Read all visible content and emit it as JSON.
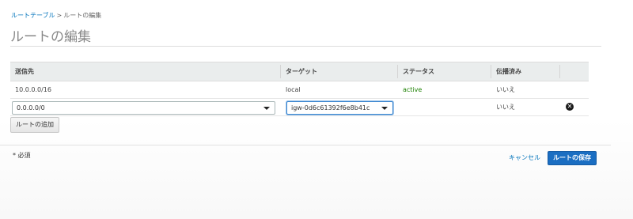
{
  "breadcrumb": {
    "parent": "ルートテーブル",
    "separator": ">",
    "current": "ルートの編集"
  },
  "page_title": "ルートの編集",
  "table": {
    "headers": {
      "destination": "送信先",
      "target": "ターゲット",
      "status": "ステータス",
      "propagated": "伝播済み"
    },
    "rows": [
      {
        "destination": "10.0.0.0/16",
        "target": "local",
        "status": "active",
        "propagated": "いいえ"
      }
    ],
    "edit_row": {
      "destination_value": "0.0.0.0/0",
      "target_value": "igw-0d6c61392f6e8b41c",
      "propagated": "いいえ",
      "remove_icon_glyph": "✕"
    }
  },
  "add_route_label": "ルートの追加",
  "footer": {
    "required_note": "* 必須",
    "cancel_label": "キャンセル",
    "save_label": "ルートの保存"
  },
  "colors": {
    "link": "#0073bb",
    "status_active": "#1d8102",
    "primary_button": "#1b6ec2"
  }
}
